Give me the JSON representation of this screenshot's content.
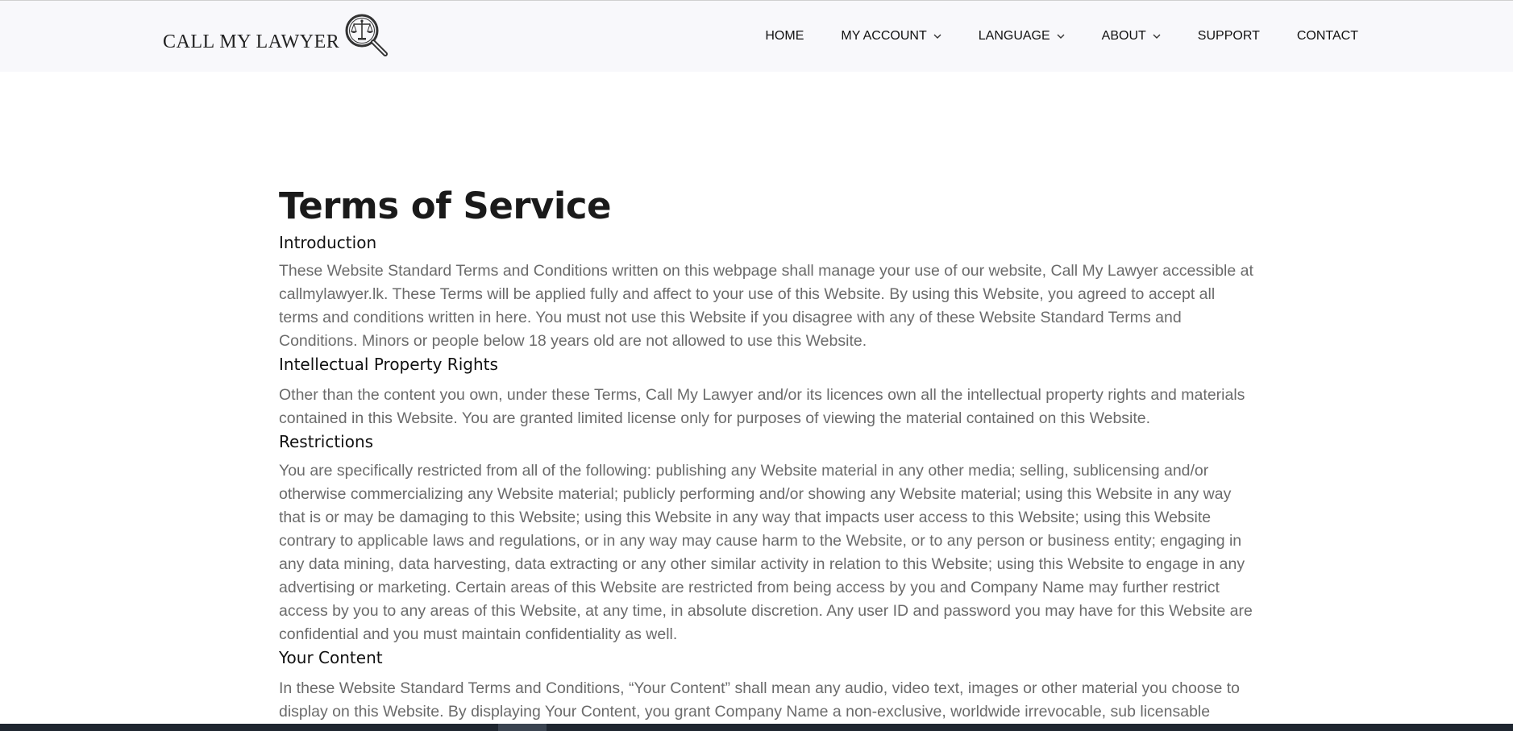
{
  "brand": {
    "name": "CALL MY LAWYER"
  },
  "nav": {
    "items": [
      {
        "label": "HOME",
        "dropdown": false
      },
      {
        "label": "MY ACCOUNT",
        "dropdown": true
      },
      {
        "label": "LANGUAGE",
        "dropdown": true
      },
      {
        "label": "ABOUT",
        "dropdown": true
      },
      {
        "label": "SUPPORT",
        "dropdown": false
      },
      {
        "label": "CONTACT",
        "dropdown": false
      }
    ]
  },
  "page": {
    "title": "Terms of Service",
    "sections": [
      {
        "heading": "Introduction",
        "body": "These Website Standard Terms and Conditions written on this webpage shall manage your use of our website, Call My Lawyer accessible at callmylawyer.lk. These Terms will be applied fully and affect to your use of this Website. By using this Website, you agreed to accept all terms and conditions written in here. You must not use this Website if you disagree with any of these Website Standard Terms and Conditions. Minors or people below 18 years old are not allowed to use this Website."
      },
      {
        "heading": "Intellectual Property Rights",
        "body": "Other than the content you own, under these Terms, Call My Lawyer and/or its licences own all the intellectual property rights and materials contained in this Website. You are granted limited license only for purposes of viewing the material contained on this Website."
      },
      {
        "heading": "Restrictions",
        "body": "You are specifically restricted from all of the following: publishing any Website material in any other media; selling, sublicensing and/or otherwise commercializing any Website material; publicly performing and/or showing any Website material; using this Website in any way that is or may be damaging to this Website; using this Website in any way that impacts user access to this Website; using this Website contrary to applicable laws and regulations, or in any way may cause harm to the Website, or to any person or business entity; engaging in any data mining, data harvesting, data extracting or any other similar activity in relation to this Website; using this Website to engage in any advertising or marketing. Certain areas of this Website are restricted from being access by you and Company Name may further restrict access by you to any areas of this Website, at any time, in absolute discretion. Any user ID and password you may have for this Website are confidential and you must maintain confidentiality as well."
      },
      {
        "heading": "Your Content",
        "body": "In these Website Standard Terms and Conditions, “Your Content” shall mean any audio, video text, images or other material you choose to display on this Website. By displaying Your Content, you grant Company Name a non-exclusive, worldwide irrevocable, sub licensable"
      }
    ]
  },
  "colors": {
    "header_bg": "#f8f8fb",
    "body_text": "#6b6b6b",
    "heading_text": "#1a1a1a",
    "taskbar_bg": "#1f2630"
  },
  "icons": [
    "scales-magnifier-logo-icon",
    "chevron-down-icon"
  ]
}
